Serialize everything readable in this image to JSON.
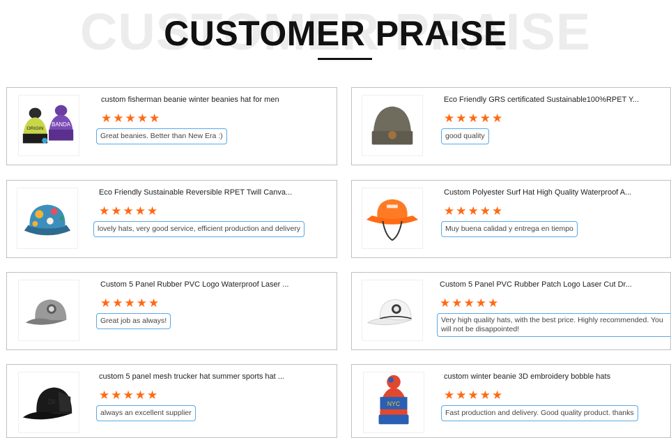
{
  "header": {
    "title": "CUSTOMER PRAISE",
    "background_text": "CUSTOMER PRAISE"
  },
  "colors": {
    "star": "#ff6a13",
    "review_border": "#58a9e6",
    "card_border": "#bfbfbf"
  },
  "reviews": [
    {
      "product": "custom fisherman beanie winter beanies hat for men",
      "rating": 5,
      "review": "Great beanies. Better than New Era :)",
      "image_icon": "beanie-pair-icon"
    },
    {
      "product": "Eco Friendly GRS certificated Sustainable100%RPET Y...",
      "rating": 5,
      "review": "good quality",
      "image_icon": "grey-beanie-icon"
    },
    {
      "product": "Eco Friendly Sustainable Reversible RPET Twill Canva...",
      "rating": 5,
      "review": "lovely hats, very good service, efficient production and delivery",
      "image_icon": "floral-bucket-hat-icon"
    },
    {
      "product": "Custom Polyester Surf Hat High Quality Waterproof A...",
      "rating": 5,
      "review": "Muy buena calidad y entrega en tiempo",
      "image_icon": "orange-surf-hat-icon"
    },
    {
      "product": "Custom 5 Panel Rubber PVC Logo Waterproof Laser ...",
      "rating": 5,
      "review": "Great job as always!",
      "image_icon": "grey-cap-icon"
    },
    {
      "product": "Custom 5 Panel PVC Rubber Patch Logo Laser Cut Dr...",
      "rating": 5,
      "review": "Very high quality hats, with the best price. Highly recommended. You will not be disappointed!",
      "image_icon": "white-cap-icon"
    },
    {
      "product": "custom 5 panel mesh trucker hat summer sports hat ...",
      "rating": 5,
      "review": "always an excellent supplier",
      "image_icon": "black-trucker-hat-icon"
    },
    {
      "product": "custom winter beanie 3D embroidery bobble hats",
      "rating": 5,
      "review": "Fast production and delivery. Good quality product. thanks",
      "image_icon": "bobble-beanie-icon"
    }
  ]
}
